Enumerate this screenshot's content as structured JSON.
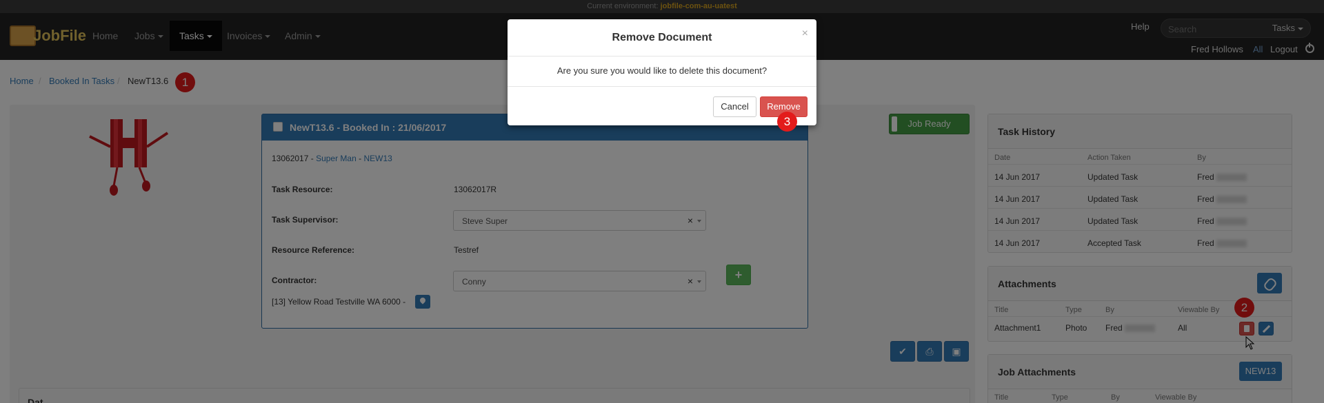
{
  "environment": {
    "prefix": "Current environment:",
    "name": "jobfile-com-au-uatest"
  },
  "brand": {
    "name": "JobFile"
  },
  "nav": {
    "home": "Home",
    "jobs": "Jobs",
    "tasks": "Tasks",
    "invoices": "Invoices",
    "admin": "Admin",
    "help": "Help",
    "search_placeholder": "Search",
    "search_scope": "Tasks",
    "user": "Fred Hollows",
    "all": "All",
    "logout": "Logout"
  },
  "breadcrumb": {
    "home": "Home",
    "booked": "Booked In Tasks",
    "current": "NewT13.6"
  },
  "badges": {
    "one": "1",
    "two": "2",
    "three": "3"
  },
  "task": {
    "heading": "NewT13.6 - Booked In : 21/06/2017",
    "ref_number": "13062017",
    "dash": "-",
    "customer": "Super Man",
    "job": "NEW13",
    "resource_label": "Task Resource:",
    "resource_value": "13062017R",
    "supervisor_label": "Task Supervisor:",
    "supervisor_value": "Steve Super",
    "resource_ref_label": "Resource Reference:",
    "resource_ref_value": "Testref",
    "contractor_label": "Contractor:",
    "contractor_value": "Conny",
    "address": "[13] Yellow Road Testville WA 6000 -",
    "clear_symbol": "×",
    "plus_symbol": "+"
  },
  "job_ready": "Job Ready",
  "data_panel_title": "Dat",
  "history": {
    "title": "Task History",
    "columns": [
      "Date",
      "Action Taken",
      "By"
    ],
    "rows": [
      {
        "date": "14 Jun 2017",
        "action": "Updated Task",
        "by": "Fred"
      },
      {
        "date": "14 Jun 2017",
        "action": "Updated Task",
        "by": "Fred"
      },
      {
        "date": "14 Jun 2017",
        "action": "Updated Task",
        "by": "Fred"
      },
      {
        "date": "14 Jun 2017",
        "action": "Accepted Task",
        "by": "Fred"
      }
    ]
  },
  "attachments": {
    "title": "Attachments",
    "columns": [
      "Title",
      "Type",
      "By",
      "Viewable By"
    ],
    "row": {
      "title": "Attachment1",
      "type": "Photo",
      "by": "Fred",
      "viewable": "All"
    }
  },
  "job_attachments": {
    "title": "Job Attachments",
    "button": "NEW13",
    "columns": [
      "Title",
      "Type",
      "By",
      "Viewable By"
    ]
  },
  "modal": {
    "title": "Remove Document",
    "close": "×",
    "body": "Are you sure you would like to delete this document?",
    "cancel": "Cancel",
    "remove": "Remove"
  },
  "colors": {
    "primary": "#337ab7",
    "danger": "#d9534f",
    "success": "#5cb85c",
    "badge": "#e31b1b"
  }
}
